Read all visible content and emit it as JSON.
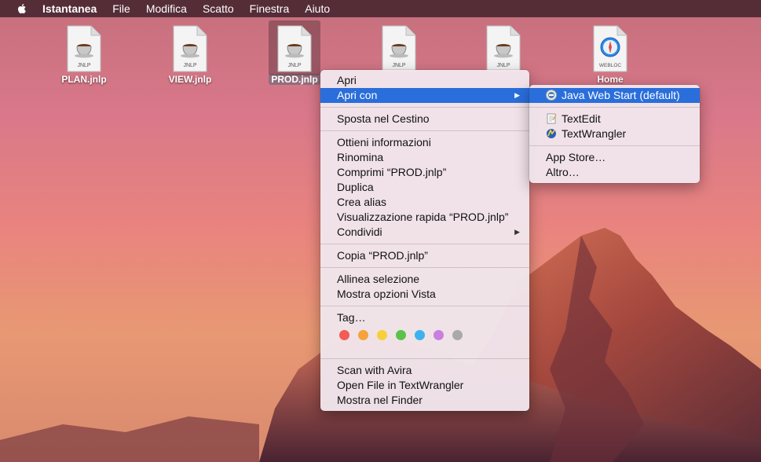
{
  "menubar": {
    "app_name": "Istantanea",
    "items": [
      "File",
      "Modifica",
      "Scatto",
      "Finestra",
      "Aiuto"
    ]
  },
  "desktop": {
    "icons": [
      {
        "label": "PLAN.jnlp",
        "badge": "JNLP"
      },
      {
        "label": "VIEW.jnlp",
        "badge": "JNLP"
      },
      {
        "label": "PROD.jnlp",
        "badge": "JNLP",
        "selected": true
      },
      {
        "label": "",
        "badge": "JNLP"
      },
      {
        "label": "",
        "badge": "JNLP"
      },
      {
        "label": "Home",
        "badge": "WEBLOC"
      }
    ]
  },
  "context_menu": {
    "group1": [
      "Apri",
      "Apri con"
    ],
    "group2": [
      "Sposta nel Cestino"
    ],
    "group3": [
      "Ottieni informazioni",
      "Rinomina",
      "Comprimi “PROD.jnlp”",
      "Duplica",
      "Crea alias",
      "Visualizzazione rapida “PROD.jnlp”",
      "Condividi"
    ],
    "group4": [
      "Copia “PROD.jnlp”"
    ],
    "group5": [
      "Allinea selezione",
      "Mostra opzioni Vista"
    ],
    "group6": [
      "Tag…"
    ],
    "tag_colors": [
      "#f25b56",
      "#f7a23b",
      "#f7cf3b",
      "#5ac24c",
      "#3eb1ef",
      "#c97fe0",
      "#a9a9ab"
    ],
    "group7": [
      "Scan with Avira",
      "Open File in TextWrangler",
      "Mostra nel Finder"
    ]
  },
  "submenu": {
    "group1": [
      "Java Web Start (default)"
    ],
    "group2": [
      "TextEdit",
      "TextWrangler"
    ],
    "group3": [
      "App Store…",
      "Altro…"
    ]
  },
  "colors": {
    "highlight": "#2a6edb"
  }
}
